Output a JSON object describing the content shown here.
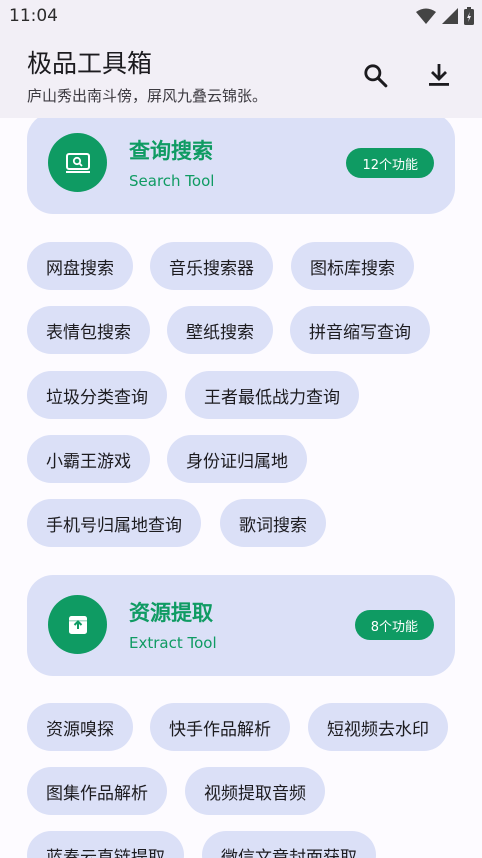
{
  "status": {
    "time": "11:04"
  },
  "appbar": {
    "title": "极品工具箱",
    "subtitle": "庐山秀出南斗傍，屏风九叠云锦张。",
    "search_icon": "search-icon",
    "download_icon": "download-icon"
  },
  "sections": [
    {
      "title": "查询搜索",
      "subtitle": "Search Tool",
      "count": "12个功能",
      "icon": "search-screen-icon",
      "chips": [
        "网盘搜索",
        "音乐搜索器",
        "图标库搜索",
        "表情包搜索",
        "壁纸搜索",
        "拼音缩写查询",
        "垃圾分类查询",
        "王者最低战力查询",
        "小霸王游戏",
        "身份证归属地",
        "手机号归属地查询",
        "歌词搜索"
      ]
    },
    {
      "title": "资源提取",
      "subtitle": "Extract Tool",
      "count": "8个功能",
      "icon": "extract-box-icon",
      "chips": [
        "资源嗅探",
        "快手作品解析",
        "短视频去水印",
        "图集作品解析",
        "视频提取音频",
        "蓝奏云直链提取",
        "微信文章封面获取"
      ]
    }
  ],
  "colors": {
    "accent": "#0f9b63",
    "card_bg": "#dbe0f7",
    "appbar_bg": "#f2eff6"
  }
}
